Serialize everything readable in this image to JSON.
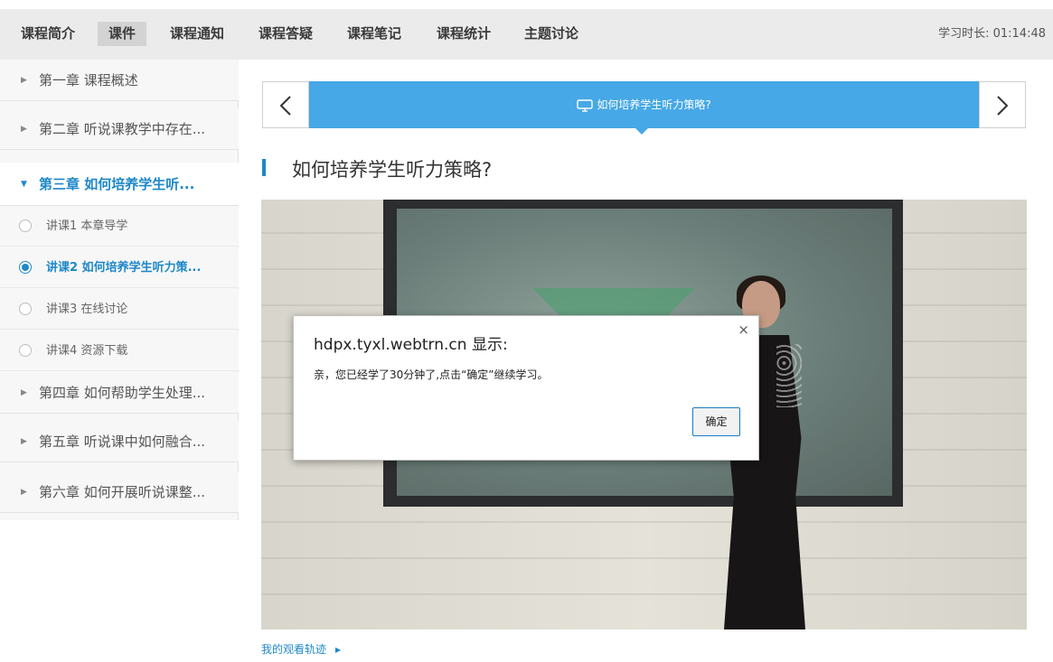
{
  "topnav": {
    "tabs": [
      {
        "label": "课程简介",
        "active": false
      },
      {
        "label": "课件",
        "active": true
      },
      {
        "label": "课程通知",
        "active": false
      },
      {
        "label": "课程答疑",
        "active": false
      },
      {
        "label": "课程笔记",
        "active": false
      },
      {
        "label": "课程统计",
        "active": false
      },
      {
        "label": "主题讨论",
        "active": false
      }
    ],
    "study_time": "学习时长: 01:14:48"
  },
  "sidebar": {
    "chapters": [
      {
        "label": "第一章 课程概述",
        "expanded": false
      },
      {
        "label": "第二章 听说课教学中存在...",
        "expanded": false
      },
      {
        "label": "第三章 如何培养学生听...",
        "expanded": true
      },
      {
        "label": "第四章 如何帮助学生处理...",
        "expanded": false
      },
      {
        "label": "第五章 听说课中如何融合...",
        "expanded": false
      },
      {
        "label": "第六章 如何开展听说课整...",
        "expanded": false
      }
    ],
    "lessons": [
      {
        "label": "讲课1 本章导学",
        "active": false
      },
      {
        "label": "讲课2 如何培养学生听力策...",
        "active": true
      },
      {
        "label": "讲课3 在线讨论",
        "active": false
      },
      {
        "label": "讲课4 资源下载",
        "active": false
      }
    ]
  },
  "banner": {
    "title": "如何培养学生听力策略?",
    "icon": "monitor-icon",
    "color": "#46a8e6"
  },
  "content": {
    "heading": "如何培养学生听力策略?",
    "track_link": "我的观看轨迹"
  },
  "dialog": {
    "title": "hdpx.tyxl.webtrn.cn 显示:",
    "message": "亲，您已经学了30分钟了,点击“确定”继续学习。",
    "ok_label": "确定",
    "close_symbol": "×"
  },
  "colors": {
    "accent": "#1e88c8",
    "nav_bg": "#ebebeb"
  }
}
